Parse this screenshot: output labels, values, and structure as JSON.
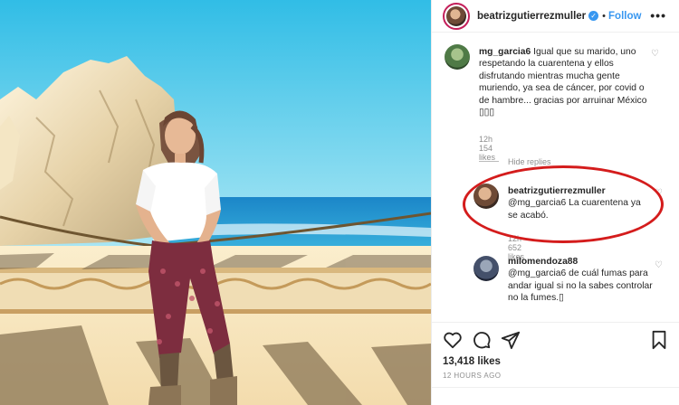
{
  "post": {
    "author": "beatrizgutierrezmuller",
    "dot": "•",
    "follow_label": "Follow",
    "more_label": "•••"
  },
  "comments": [
    {
      "username": "mg_garcia6",
      "text": "Igual que su marido, uno respetando la cuarentena y ellos disfrutando mientras mucha gente muriendo, ya sea de cáncer, por covid o de hambre... gracias por arruinar México ▯▯▯",
      "time": "12h",
      "likes": "154 likes"
    },
    {
      "username": "beatrizgutierrezmuller",
      "text": "@mg_garcia6 La cuarentena ya se acabó.",
      "time": "12h",
      "likes": "652 likes"
    },
    {
      "username": "milomendoza88",
      "text": "@mg_garcia6 de cuál fumas para andar igual si no la sabes controlar no la fumes.▯",
      "time": "",
      "likes": ""
    }
  ],
  "hide_replies_label": "Hide replies",
  "engagement": {
    "likes": "13,418 likes",
    "posted": "12 HOURS AGO"
  },
  "icons": [
    "heart-icon",
    "comment-icon",
    "share-icon",
    "bookmark-icon",
    "verified-icon",
    "more-icon"
  ],
  "colors": {
    "link": "#3897f0",
    "annotation": "#d41c1c",
    "muted": "#8e8e8e"
  }
}
